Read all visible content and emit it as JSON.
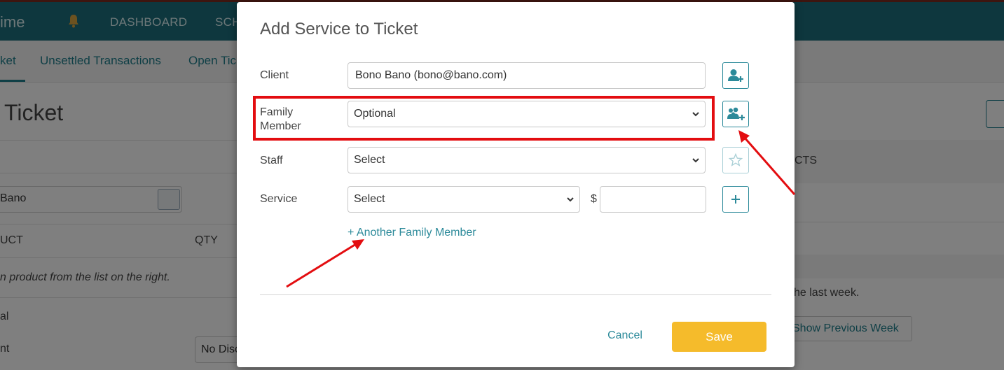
{
  "app": {
    "logo": "ime",
    "nav": [
      "DASHBOARD",
      "SCH"
    ],
    "subnav": [
      "ket",
      "Unsettled Transactions",
      "Open Tic"
    ],
    "page_title": "Ticket",
    "client_value": "Bano",
    "col_product": "UCT",
    "col_qty": "QTY",
    "empty_hint": "n product from the list on the right.",
    "row_total": "al",
    "row_discount": "nt",
    "discount_value": "No Disc",
    "right_header": "CTS",
    "right_hint": "he last week.",
    "prev_week_label": "Show Previous Week"
  },
  "modal": {
    "title": "Add Service to Ticket",
    "client": {
      "label": "Client",
      "value": "Bono Bano (bono@bano.com)"
    },
    "family": {
      "label": "Family Member",
      "selected": "Optional"
    },
    "staff": {
      "label": "Staff",
      "selected": "Select"
    },
    "service": {
      "label": "Service",
      "selected": "Select",
      "currency": "$",
      "price": ""
    },
    "add_family_link": "+ Another Family Member",
    "cancel_label": "Cancel",
    "save_label": "Save"
  },
  "colors": {
    "teal": "#1c6f7c",
    "accent": "#2c8a9a",
    "save": "#f5bb2b",
    "annotation": "#e30d10"
  },
  "icons": [
    "bell-icon",
    "add-client-icon",
    "add-family-icon",
    "star-icon",
    "plus-icon",
    "chevron-down-icon",
    "print-icon"
  ]
}
